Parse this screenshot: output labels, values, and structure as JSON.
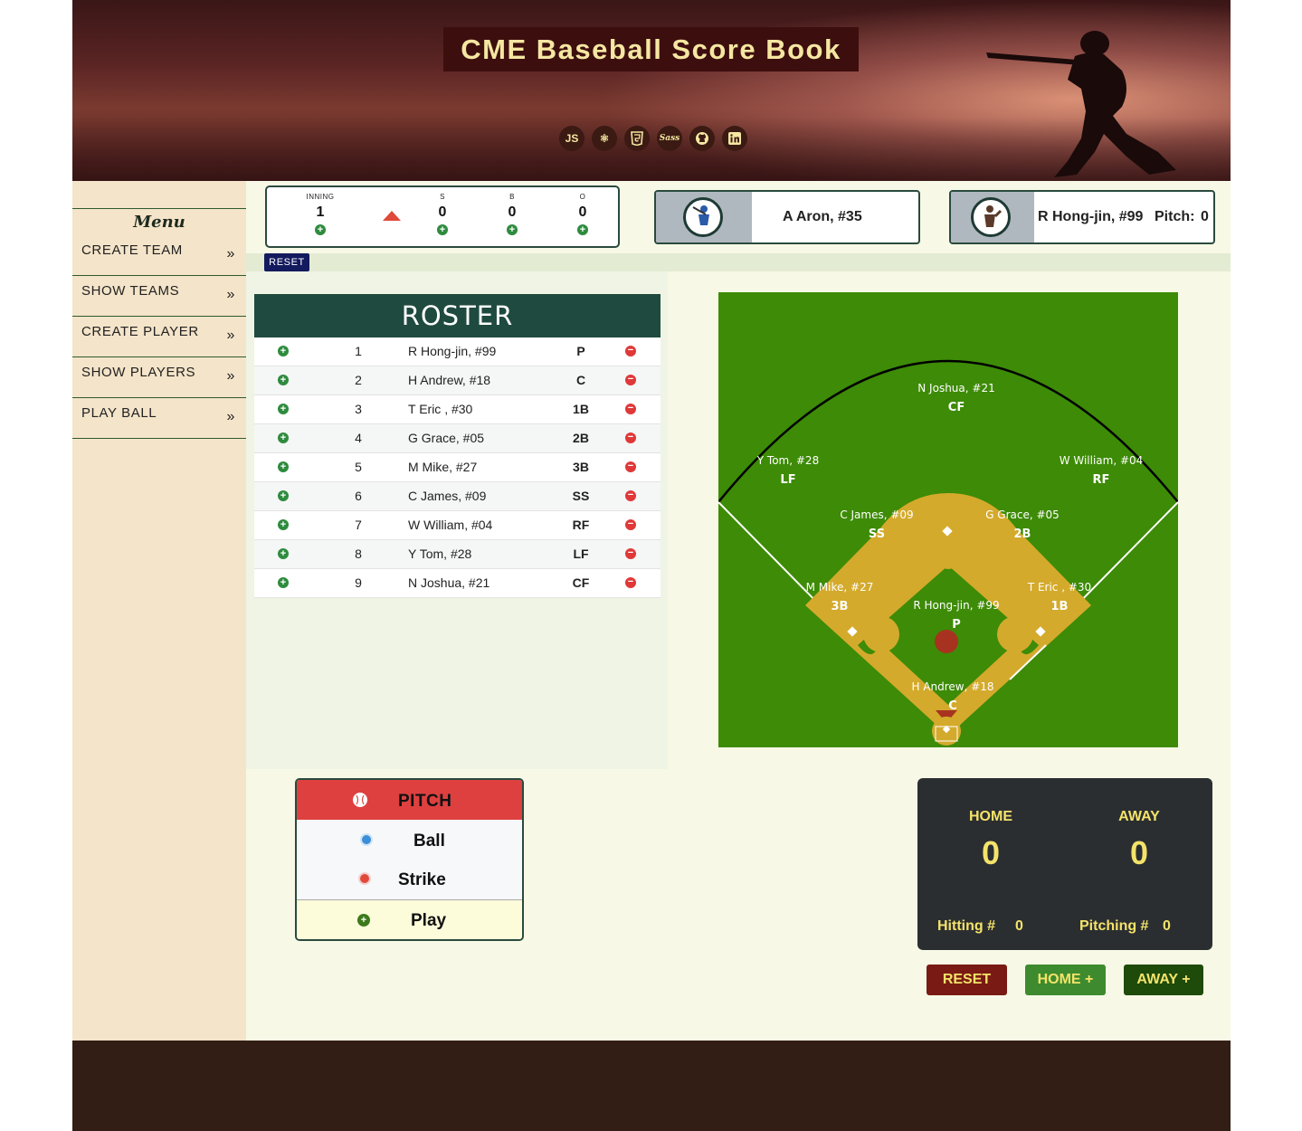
{
  "header": {
    "title": "CME Baseball Score Book",
    "tech_icons": [
      {
        "label": "JS",
        "icon": "javascript-icon"
      },
      {
        "label": "⚛",
        "icon": "react-icon"
      },
      {
        "label": "5",
        "icon": "html5-icon"
      },
      {
        "label": "Sass",
        "icon": "sass-icon"
      },
      {
        "label": "",
        "icon": "github-icon"
      },
      {
        "label": "in",
        "icon": "linkedin-icon"
      }
    ]
  },
  "sidebar": {
    "title": "Menu",
    "items": [
      {
        "label": "CREATE TEAM"
      },
      {
        "label": "SHOW TEAMS"
      },
      {
        "label": "CREATE PLAYER"
      },
      {
        "label": "SHOW PLAYERS"
      },
      {
        "label": "PLAY BALL"
      }
    ],
    "chevron": "»"
  },
  "count": {
    "inning_label": "INNING",
    "inning": "1",
    "strikes_label": "S",
    "strikes": "0",
    "balls_label": "B",
    "balls": "0",
    "outs_label": "O",
    "outs": "0",
    "half": "top"
  },
  "batter": {
    "name": "A Aron, #35"
  },
  "pitcher": {
    "name": "R Hong-jin, #99",
    "pitch_label": "Pitch:",
    "pitch_count": "0"
  },
  "reset_small": "RESET",
  "roster": {
    "title": "ROSTER",
    "rows": [
      {
        "order": "1",
        "name": "R Hong-jin, #99",
        "pos": "P"
      },
      {
        "order": "2",
        "name": "H Andrew, #18",
        "pos": "C"
      },
      {
        "order": "3",
        "name": "T Eric , #30",
        "pos": "1B"
      },
      {
        "order": "4",
        "name": "G Grace, #05",
        "pos": "2B"
      },
      {
        "order": "5",
        "name": "M Mike, #27",
        "pos": "3B"
      },
      {
        "order": "6",
        "name": "C James, #09",
        "pos": "SS"
      },
      {
        "order": "7",
        "name": "W William, #04",
        "pos": "RF"
      },
      {
        "order": "8",
        "name": "Y Tom, #28",
        "pos": "LF"
      },
      {
        "order": "9",
        "name": "N Joshua, #21",
        "pos": "CF"
      }
    ]
  },
  "field": {
    "positions": {
      "cf": {
        "name": "N Joshua, #21",
        "abbr": "CF"
      },
      "lf": {
        "name": "Y Tom, #28",
        "abbr": "LF"
      },
      "rf": {
        "name": "W William, #04",
        "abbr": "RF"
      },
      "ss": {
        "name": "C James, #09",
        "abbr": "SS"
      },
      "second": {
        "name": "G Grace, #05",
        "abbr": "2B"
      },
      "third": {
        "name": "M Mike, #27",
        "abbr": "3B"
      },
      "first": {
        "name": "T Eric , #30",
        "abbr": "1B"
      },
      "pitcher": {
        "name": "R Hong-jin, #99",
        "abbr": "P"
      },
      "catcher": {
        "name": "H Andrew, #18",
        "abbr": "C"
      }
    }
  },
  "pitch_panel": {
    "title": "PITCH",
    "ball": "Ball",
    "strike": "Strike",
    "play": "Play"
  },
  "scoreboard": {
    "home_label": "HOME",
    "away_label": "AWAY",
    "home_score": "0",
    "away_score": "0",
    "hitting_label": "Hitting #",
    "hitting": "0",
    "pitching_label": "Pitching #",
    "pitching": "0"
  },
  "buttons": {
    "reset": "RESET",
    "home_plus": "HOME +",
    "away_plus": "AWAY +"
  },
  "colors": {
    "header_title_bg": "#3d0e0e",
    "header_title_text": "#f5e7a1",
    "roster_header": "#1f4a3f",
    "field_grass": "#3d8b06",
    "infield_dirt": "#d4aa2c",
    "pitch_header": "#de4040",
    "scoreboard_bg": "#2b2e31",
    "scoreboard_text": "#f4e36a",
    "reset_button": "#7a1a14",
    "home_button": "#3d8b2e",
    "away_button": "#1e4a0a",
    "footer": "#321e14"
  }
}
